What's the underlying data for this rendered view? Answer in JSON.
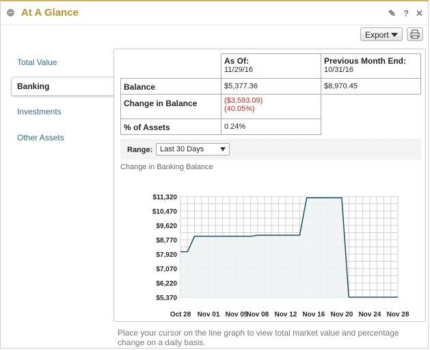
{
  "header": {
    "title": "At A Glance"
  },
  "toolbar": {
    "export_label": "Export"
  },
  "nav": [
    {
      "label": "Total Value"
    },
    {
      "label": "Banking"
    },
    {
      "label": "Investments"
    },
    {
      "label": "Other Assets"
    }
  ],
  "summary": {
    "as_of_label": "As Of:",
    "as_of_date": "11/29/16",
    "prev_label": "Previous Month End:",
    "prev_date": "10/31/16",
    "balance_label": "Balance",
    "balance_asof": "$5,377.36",
    "balance_prev": "$8,970.45",
    "change_label": "Change in Balance",
    "change_amount": "($3,593.09)",
    "change_pct": "(40.05%)",
    "assets_label": "% of Assets",
    "assets_value": "0.24%"
  },
  "range": {
    "label": "Range:",
    "selected": "Last 30 Days"
  },
  "chart_title": "Change in Banking Balance",
  "footer": "Place your cursor on the line graph to view total market value and percentage change on a daily basis.",
  "chart_data": {
    "type": "area",
    "x": [
      "Oct 28",
      "Oct 29",
      "Oct 30",
      "Oct 31",
      "Nov 01",
      "Nov 02",
      "Nov 03",
      "Nov 04",
      "Nov 05",
      "Nov 06",
      "Nov 07",
      "Nov 08",
      "Nov 09",
      "Nov 10",
      "Nov 11",
      "Nov 12",
      "Nov 13",
      "Nov 14",
      "Nov 15",
      "Nov 16",
      "Nov 17",
      "Nov 18",
      "Nov 19",
      "Nov 20",
      "Nov 21",
      "Nov 22",
      "Nov 23",
      "Nov 24",
      "Nov 25",
      "Nov 26",
      "Nov 27",
      "Nov 28"
    ],
    "values": [
      8060,
      8060,
      8970,
      8970,
      8970,
      8970,
      8970,
      8970,
      8970,
      8970,
      8970,
      9040,
      9040,
      9040,
      9040,
      9040,
      9040,
      9040,
      11250,
      11250,
      11250,
      11250,
      11250,
      11250,
      5377,
      5377,
      5377,
      5377,
      5377,
      5377,
      5377,
      5377
    ],
    "xticks": [
      "Oct 28",
      "Nov 01",
      "Nov 05",
      "Nov 08",
      "Nov 12",
      "Nov 16",
      "Nov 20",
      "Nov 24",
      "Nov 28"
    ],
    "yticks": [
      "$5,370",
      "$6,220",
      "$7,070",
      "$7,920",
      "$8,770",
      "$9,620",
      "$10,470",
      "$11,320"
    ],
    "ylim": [
      5370,
      11320
    ],
    "xlabel": "",
    "ylabel": "",
    "grid": true,
    "line_color": "#1e4f5a",
    "fill_color": "#eef3f3"
  }
}
